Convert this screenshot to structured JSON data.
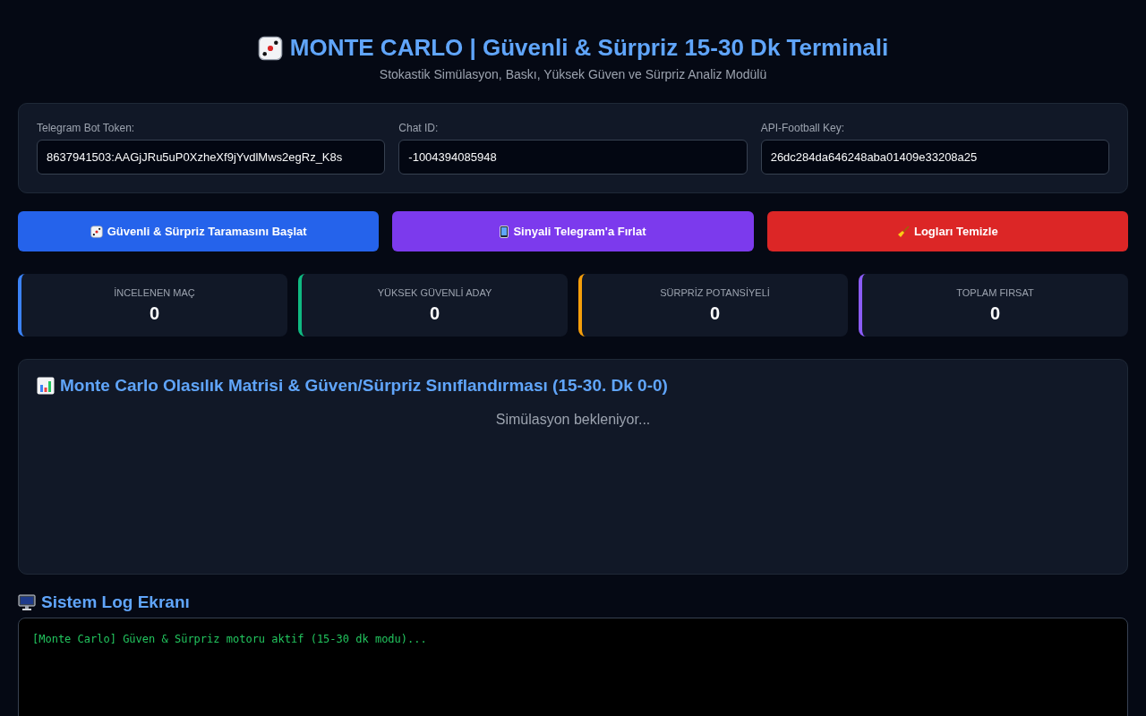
{
  "header": {
    "title": "MONTE CARLO | Güvenli & Sürpriz 15-30 Dk Terminali",
    "subtitle": "Stokastik Simülasyon, Baskı, Yüksek Güven ve Sürpriz Analiz Modülü"
  },
  "config": [
    {
      "label": "Telegram Bot Token:",
      "value": "8637941503:AAGjJRu5uP0XzheXf9jYvdlMws2egRz_K8s"
    },
    {
      "label": "Chat ID:",
      "value": "-1004394085948"
    },
    {
      "label": "API-Football Key:",
      "value": "26dc284da646248aba01409e33208a25"
    }
  ],
  "actions": [
    {
      "kind": "scan",
      "label": "Güvenli & Sürpriz Taramasını Başlat",
      "color": "#2563eb"
    },
    {
      "kind": "send",
      "label": "Sinyali Telegram'a Fırlat",
      "color": "#7c3aed"
    },
    {
      "kind": "clear",
      "label": "Logları Temizle",
      "color": "#dc2626"
    }
  ],
  "stats": [
    {
      "label": "İNCELENEN MAÇ",
      "value": "0",
      "color": "#3b82f6"
    },
    {
      "label": "YÜKSEK GÜVENLİ ADAY",
      "value": "0",
      "color": "#10b981"
    },
    {
      "label": "SÜRPRİZ POTANSİYELİ",
      "value": "0",
      "color": "#f59e0b"
    },
    {
      "label": "TOPLAM FIRSAT",
      "value": "0",
      "color": "#8b5cf6"
    }
  ],
  "matrix": {
    "title": "Monte Carlo Olasılık Matrisi & Güven/Sürpriz Sınıflandırması (15-30. Dk 0-0)",
    "status": "Simülasyon bekleniyor..."
  },
  "log": {
    "title": "Sistem Log Ekranı",
    "lines": [
      "[Monte Carlo] Güven & Sürpriz motoru aktif (15-30 dk modu)..."
    ]
  }
}
